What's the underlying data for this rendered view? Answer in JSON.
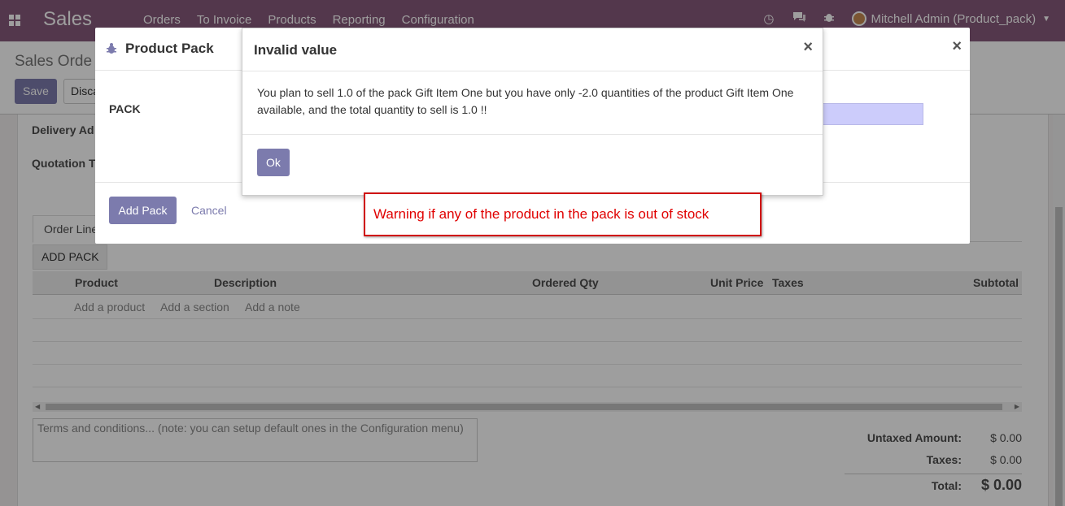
{
  "navbar": {
    "app_title": "Sales",
    "menu": [
      "Orders",
      "To Invoice",
      "Products",
      "Reporting",
      "Configuration"
    ],
    "user": "Mitchell Admin (Product_pack)",
    "icons": [
      "apps-icon",
      "clock-icon",
      "chat-icon",
      "bug-icon",
      "chevron-down-icon"
    ]
  },
  "control_panel": {
    "breadcrumb": "Sales Orde",
    "save_label": "Save",
    "discard_label": "Disca"
  },
  "form": {
    "delivery_label": "Delivery Ad",
    "quotation_label": "Quotation T",
    "tab_order_lines": "Order Line",
    "add_pack_label": "ADD PACK",
    "columns": [
      "Product",
      "Description",
      "Ordered Qty",
      "Unit Price",
      "Taxes",
      "Subtotal"
    ],
    "add_links": [
      "Add a product",
      "Add a section",
      "Add a note"
    ],
    "terms_placeholder": "Terms and conditions... (note: you can setup default ones in the Configuration menu)",
    "totals": {
      "untaxed_label": "Untaxed Amount:",
      "untaxed_value": "$ 0.00",
      "taxes_label": "Taxes:",
      "taxes_value": "$ 0.00",
      "total_label": "Total:",
      "total_value": "$ 0.00"
    }
  },
  "pack_modal": {
    "title": "Product Pack",
    "close": "×",
    "field_label": "PACK",
    "add_pack_button": "Add Pack",
    "cancel_button": "Cancel"
  },
  "invalid_modal": {
    "title": "Invalid value",
    "close": "×",
    "message": "You plan to sell 1.0 of the pack Gift Item One but you have only -2.0 quantities of the product Gift Item One available, and the total quantity to sell is 1.0 !!",
    "ok_button": "Ok"
  },
  "annotation": {
    "text": "Warning if any of the product in the pack is out of stock",
    "color": "#e00000"
  },
  "colors": {
    "brand": "#875a7b",
    "primary_button": "#7c7bad"
  }
}
